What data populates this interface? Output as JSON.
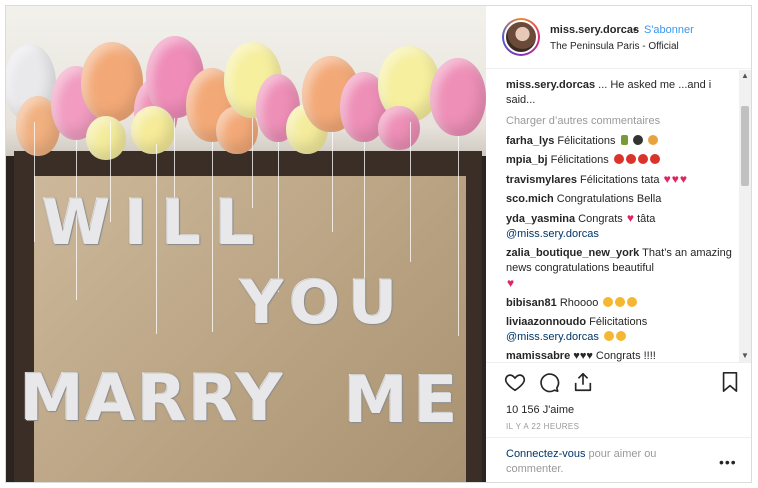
{
  "post": {
    "username": "miss.sery.dorcas",
    "separator": "•",
    "follow_label": "S'abonner",
    "location": "The Peninsula Paris - Official",
    "photo_text": {
      "line1": "WILL",
      "line2": "YOU",
      "line3_a": "MARRY",
      "line3_b": "ME"
    },
    "caption_user": "miss.sery.dorcas",
    "caption_text": "... He asked me ...and i said...",
    "load_more": "Charger d’autres commentaires",
    "comments": [
      {
        "user": "farha_lys",
        "text": "Félicitations",
        "emojis": [
          "bottle",
          "cap",
          "party"
        ]
      },
      {
        "user": "mpia_bj",
        "text": "Félicitations",
        "emojis": [
          "rose",
          "rose",
          "rose",
          "rose"
        ]
      },
      {
        "user": "travismylares",
        "text": "Félicitations tata",
        "hearts": 3
      },
      {
        "user": "sco.mich",
        "text": "Congratulations Bella"
      },
      {
        "user": "yda_yasmina",
        "text": "Congrats",
        "text2": "tâta",
        "mention": "@miss.sery.dorcas",
        "hearts": 1
      },
      {
        "user": "zalia_boutique_new_york",
        "text": "That’s an amazing news congratulations beautiful",
        "hearts": 1
      },
      {
        "user": "bibisan81",
        "text": "Rhoooo",
        "emojis": [
          "heart-eyes",
          "heart-eyes",
          "heart-eyes"
        ]
      },
      {
        "user": "liviaazonnoudo",
        "text": "Félicitations",
        "mention": "@miss.sery.dorcas",
        "emojis": [
          "smile",
          "wink"
        ]
      },
      {
        "user": "mamissabre",
        "text": "♥♥♥ Congrats !!!!"
      }
    ],
    "likes": "10 156 J'aime",
    "timestamp": "IL Y A 22 HEURES",
    "login_link": "Connectez-vous",
    "login_text": " pour aimer ou commenter.",
    "more_icon": "•••",
    "scroll_up": "▲",
    "scroll_down": "▼"
  },
  "colors": {
    "link_blue": "#3897f0",
    "mention_blue": "#003569",
    "heart_red": "#e0245e",
    "muted": "#999999"
  },
  "icons": [
    "heart-icon",
    "comment-icon",
    "share-icon",
    "bookmark-icon",
    "more-icon"
  ]
}
